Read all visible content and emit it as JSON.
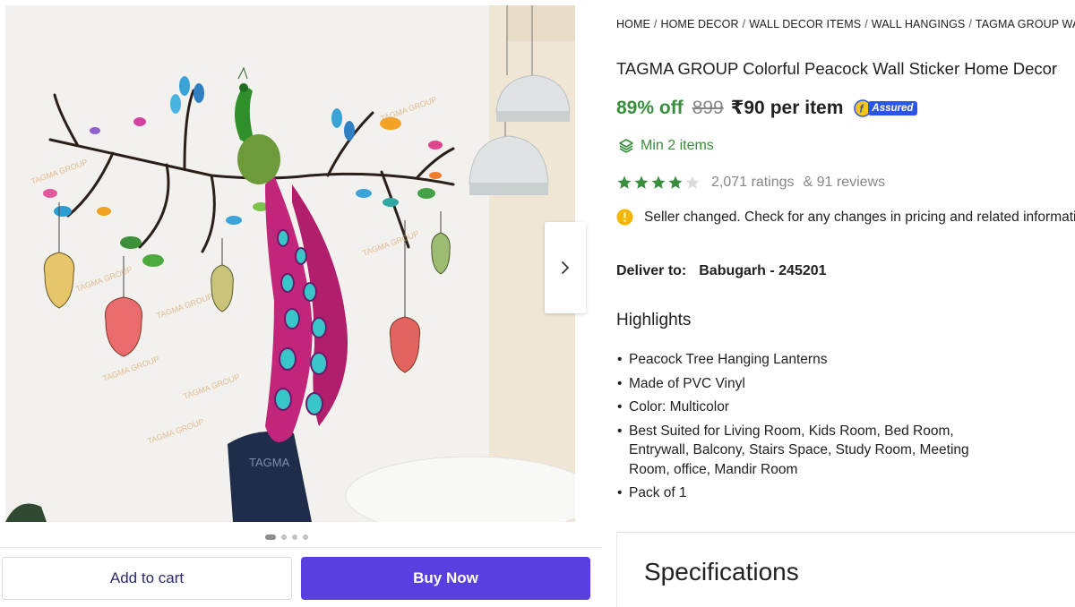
{
  "gallery": {
    "watermark": "TAGMA GROUP",
    "chair_logo": "TAGMA",
    "dots_count": 4,
    "active_dot": 0
  },
  "actions": {
    "add_to_cart": "Add to cart",
    "buy_now": "Buy Now"
  },
  "breadcrumb": [
    "HOME",
    "HOME DECOR",
    "WALL DECOR ITEMS",
    "WALL HANGINGS",
    "TAGMA GROUP WALL HANGINGS"
  ],
  "product": {
    "title": "TAGMA GROUP Colorful Peacock Wall Sticker Home Decor",
    "discount": "89% off",
    "mrp": "899",
    "price": "₹90",
    "price_unit": "per item",
    "assured": "Assured",
    "min_qty": "Min 2 items",
    "rating_value": 4,
    "ratings_text": "2,071 ratings",
    "reviews_text": "& 91 reviews",
    "notice": "Seller changed. Check for any changes in pricing and related information"
  },
  "delivery": {
    "label": "Deliver to:",
    "location": "Babugarh - 245201"
  },
  "highlights": {
    "title": "Highlights",
    "items": [
      "Peacock Tree Hanging Lanterns",
      "Made of PVC Vinyl",
      "Color: Multicolor",
      "Best Suited for Living Room, Kids Room, Bed Room, Entrywall, Balcony, Stairs Space, Study Room, Meeting Room, office, Mandir Room",
      "Pack of 1"
    ]
  },
  "specifications": {
    "title": "Specifications"
  },
  "colors": {
    "buy_button": "#5a3fe0",
    "discount_green": "#388e3c",
    "star_green": "#388e3c",
    "assured_blue": "#2a55e5",
    "notice_yellow": "#f5b600"
  },
  "icons": {
    "next": "chevron-right-icon",
    "min_items": "layers-icon",
    "notice": "info-icon",
    "assured": "assured-badge-icon",
    "star": "star-icon"
  }
}
